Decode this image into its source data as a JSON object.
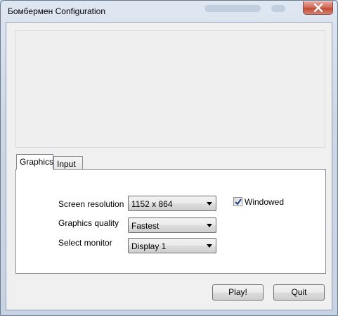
{
  "window": {
    "title": "Бомбермен Configuration",
    "close_icon": "close-icon"
  },
  "tabs": [
    {
      "label": "Graphics",
      "selected": true
    },
    {
      "label": "Input",
      "selected": false
    }
  ],
  "graphics": {
    "screen_resolution": {
      "label": "Screen resolution",
      "value": "1152 x 864"
    },
    "graphics_quality": {
      "label": "Graphics quality",
      "value": "Fastest"
    },
    "select_monitor": {
      "label": "Select monitor",
      "value": "Display 1"
    },
    "windowed": {
      "label": "Windowed",
      "checked": true
    }
  },
  "buttons": {
    "play": "Play!",
    "quit": "Quit"
  }
}
